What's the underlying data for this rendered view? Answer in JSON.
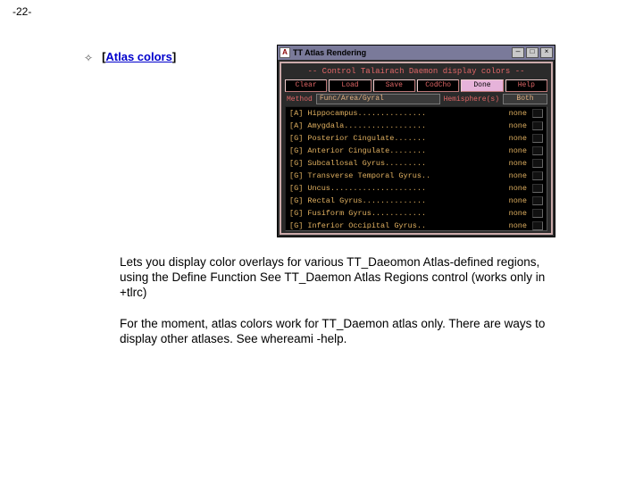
{
  "page_number": "-22-",
  "section": {
    "bullet_glyph": "✧",
    "title": "Atlas colors",
    "open_bracket": "[",
    "close_bracket": "]"
  },
  "app_window": {
    "title": "TT Atlas Rendering",
    "icon_char": "A",
    "minimize": "—",
    "maximize": "□",
    "close": "×",
    "subtitle": "-- Control Talairach Daemon display colors --",
    "buttons": [
      "Clear",
      "Load",
      "Save",
      "CodCho",
      "Done",
      "Help"
    ],
    "highlighted_button_index": 4,
    "method_label": "Method",
    "method_value": "Func/Area/Gyral",
    "hemi_label": "Hemisphere(s)",
    "hemi_value": "Both",
    "rows": [
      {
        "tag": "[A]",
        "name": "Hippocampus",
        "val": "none"
      },
      {
        "tag": "[A]",
        "name": "Amygdala",
        "val": "none"
      },
      {
        "tag": "[G]",
        "name": "Posterior Cingulate",
        "val": "none"
      },
      {
        "tag": "[G]",
        "name": "Anterior Cingulate",
        "val": "none"
      },
      {
        "tag": "[G]",
        "name": "Subcallosal Gyrus",
        "val": "none"
      },
      {
        "tag": "[G]",
        "name": "Transverse Temporal Gyrus",
        "val": "none"
      },
      {
        "tag": "[G]",
        "name": "Uncus",
        "val": "none"
      },
      {
        "tag": "[G]",
        "name": "Rectal Gyrus",
        "val": "none"
      },
      {
        "tag": "[G]",
        "name": "Fusiform Gyrus",
        "val": "none"
      },
      {
        "tag": "[G]",
        "name": "Inferior Occipital Gyrus",
        "val": "none"
      }
    ]
  },
  "paragraphs": {
    "p1": "Lets you display color overlays for various TT_Daeomon Atlas-defined regions, using the Define Function  See TT_Daemon Atlas Regions control (works only in +tlrc)",
    "p2": "For the moment, atlas colors work for TT_Daemon atlas only. There are ways to display other atlases. See whereami -help."
  }
}
